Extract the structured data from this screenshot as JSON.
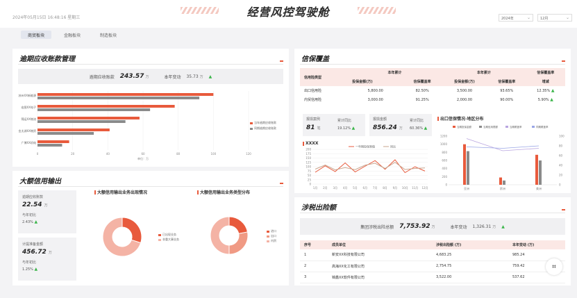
{
  "header": {
    "datetime": "2024年05月15日 16:48:16 星期三",
    "title": "经营风控驾驶舱",
    "year_select": "2024年",
    "month_select": "12月"
  },
  "tabs": [
    {
      "label": "商贸板块",
      "active": true
    },
    {
      "label": "金融板块",
      "active": false
    },
    {
      "label": "制造板块",
      "active": false
    }
  ],
  "overdue": {
    "title": "逾期应收账款管理",
    "summary_label": "逾期应收账款",
    "summary_value": "243.57",
    "summary_unit": "万",
    "change_label": "本年变动",
    "change_value": "35.73",
    "change_unit": "万",
    "axis_unit": "单位：万",
    "legend": [
      "当年逾期应收账款",
      "同期逾期应收账款"
    ]
  },
  "guarantee": {
    "title": "信保覆盖",
    "group1": "本年累计",
    "group2": "本年累计",
    "col_type": "信用险类型",
    "col_amount1": "投保金额(万)",
    "col_rate1": "信保覆盖率",
    "col_amount2": "投保金额(万)",
    "col_rate2": "信保覆盖率",
    "col_change_l1": "信保覆盖率",
    "col_change_l2": "增减",
    "rows": [
      {
        "type": "出口信用险",
        "a1": "5,800.00",
        "r1": "82.50%",
        "a2": "3,500.00",
        "r2": "93.65%",
        "chg": "12.35%"
      },
      {
        "type": "内贸信用险",
        "a1": "3,000.00",
        "r1": "91.25%",
        "a2": "2,000.00",
        "r2": "90.00%",
        "chg": "5.90%"
      }
    ]
  },
  "claims": {
    "case_label": "报损案例",
    "case_value": "81",
    "case_unit": "笔",
    "case_yoy_label": "累计同比",
    "case_yoy": "19.12%",
    "amt_label": "报损金额",
    "amt_value": "856.24",
    "amt_unit": "万",
    "amt_yoy_label": "累计同比",
    "amt_yoy": "60.36%"
  },
  "xxxx_chart_title": "XXXX",
  "region_chart_title": "出口信保情况-地区分布",
  "big_credit": {
    "title": "大额信用输出",
    "card1_label": "逾期应收账款",
    "card1_value": "22.54",
    "card1_unit": "万",
    "card1_ratio_label": "与年初比",
    "card1_ratio": "2.43%",
    "card2_label": "计提准备金额",
    "card2_value": "456.72",
    "card2_unit": "万",
    "card2_ratio_label": "与年初比",
    "card2_ratio": "1.25%",
    "pie1_title": "大额信用输出业务出现情况",
    "pie1_legend": [
      "已出现业务",
      "非重大事业务"
    ],
    "pie2_title": "大额信用输出业务类型分布",
    "pie2_legend": [
      "进口",
      "出口",
      "内贸"
    ]
  },
  "tax": {
    "title": "涉税出险额",
    "summary_label": "集团涉税出险总额",
    "summary_value": "7,753.92",
    "summary_unit": "万",
    "change_label": "本年变动",
    "change_value": "1,326.31",
    "change_unit": "万",
    "headers": [
      "序号",
      "成员单位",
      "涉税出险额 (万)",
      "本年变动 (万)"
    ],
    "rows": [
      {
        "no": "1",
        "unit": "新安XX科技有限公司",
        "amount": "4,683.25",
        "change": "985.24"
      },
      {
        "no": "2",
        "unit": "高海XX化工有限公司",
        "amount": "2,754.75",
        "change": "759.42"
      },
      {
        "no": "3",
        "unit": "锦鑫XX软件有限公司",
        "amount": "3,522.00",
        "change": "537.62"
      }
    ]
  },
  "colors": {
    "accent": "#e85a3c",
    "grey": "#8a8a8a",
    "pink": "#f4b3a5",
    "blue": "#9aa6e6"
  },
  "chart_data": [
    {
      "type": "bar",
      "orientation": "horizontal",
      "categories": [
        "苏州XX新能源",
        "宏图XX电子",
        "锦运XX物流",
        "金太湖XX物资",
        "广博XX机电"
      ],
      "series": [
        {
          "name": "当年逾期应收账款",
          "values": [
            100,
            78,
            58,
            41,
            18
          ]
        },
        {
          "name": "同期逾期应收账款",
          "values": [
            92,
            64,
            50,
            32,
            14
          ]
        }
      ],
      "xlim": [
        0,
        120
      ],
      "xticks": [
        "0",
        "20",
        "40",
        "60",
        "80",
        "100",
        "120"
      ],
      "xlabel": "单位：万"
    },
    {
      "type": "line",
      "title": "XXXX",
      "categories": [
        "1月",
        "2月",
        "3月",
        "4月",
        "5月",
        "6月",
        "7月",
        "8月",
        "9月",
        "10月",
        "11月",
        "12月"
      ],
      "series": [
        {
          "name": "一年期投保案值",
          "values": [
            68,
            105,
            72,
            122,
            70,
            103,
            135,
            85,
            140,
            66,
            100,
            75
          ]
        },
        {
          "name": "同比",
          "values": [
            86,
            110,
            82,
            95,
            83,
            109,
            120,
            90,
            125,
            84,
            90,
            93
          ]
        }
      ],
      "ylim": [
        0,
        200
      ],
      "yticks": [
        "0",
        "25",
        "50",
        "75",
        "100",
        "125",
        "150",
        "175",
        "200"
      ]
    },
    {
      "type": "bar",
      "title": "出口信保情况-地区分布",
      "categories": [
        "亚洲",
        "欧洲",
        "美洲"
      ],
      "series": [
        {
          "name": "当期投保金额",
          "values": [
            1000,
            180,
            740
          ]
        },
        {
          "name": "当期信用限额",
          "values": [
            830,
            105,
            600
          ]
        },
        {
          "name": "当期覆盖率",
          "values": [
            95,
            70,
            75
          ]
        },
        {
          "name": "同期覆盖率",
          "values": [
            78,
            75,
            80
          ]
        }
      ],
      "ylim": [
        0,
        1200
      ],
      "yticks": [
        "0",
        "200",
        "400",
        "600",
        "800",
        "1000",
        "1200"
      ],
      "y2lim": [
        0,
        100
      ],
      "y2ticks": [
        "0",
        "20",
        "40",
        "60",
        "80",
        "100"
      ]
    },
    {
      "type": "pie",
      "title": "大额信用输出业务出现情况",
      "categories": [
        "已出现业务",
        "非重大事业务"
      ],
      "values": [
        30,
        70
      ]
    },
    {
      "type": "pie",
      "title": "大额信用输出业务类型分布",
      "categories": [
        "进口",
        "出口",
        "内贸"
      ],
      "values": [
        22,
        28,
        50
      ]
    }
  ]
}
